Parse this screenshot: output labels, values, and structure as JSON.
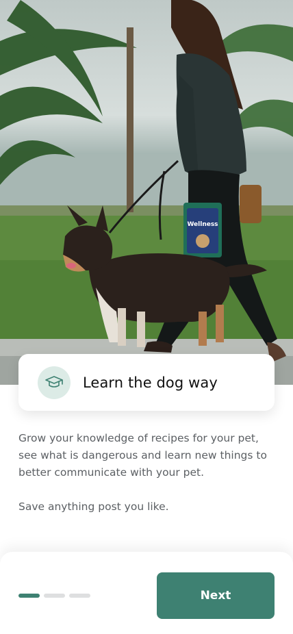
{
  "onboarding": {
    "card": {
      "icon": "graduation-cap-icon",
      "title": "Learn the dog way"
    },
    "description": [
      "Grow your knowledge of recipes for your pet, see what is dangerous and learn new things to better communicate with your pet.",
      "Save anything post you like."
    ],
    "pager": {
      "current_step": 1,
      "total_steps": 3
    },
    "next_button": {
      "label": "Next"
    },
    "product_bag_label": "Wellness"
  },
  "colors": {
    "accent": "#3e8172",
    "icon_bg": "#dcebe6",
    "inactive_dot": "#dedfe0",
    "body_text": "#5b5f63"
  }
}
